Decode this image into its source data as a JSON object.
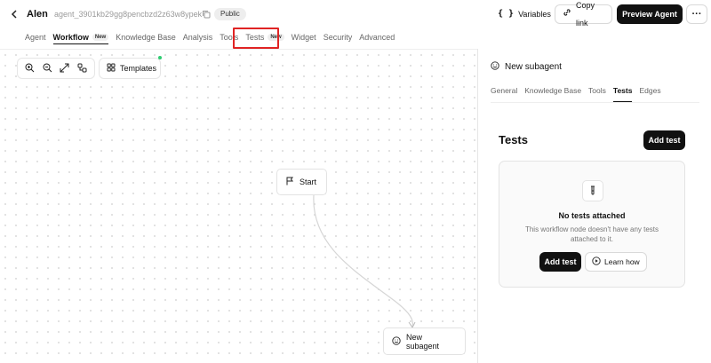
{
  "header": {
    "back_icon": "chevron-left-icon",
    "agent_name": "Alen",
    "agent_id": "agent_3901kb29gg8pencbzd2z63w8ypek",
    "visibility_badge": "Public",
    "variables_label": "Variables",
    "copy_link_label": "Copy link",
    "preview_label": "Preview Agent",
    "more_icon": "more-horizontal-icon"
  },
  "tabs": [
    {
      "label": "Agent"
    },
    {
      "label": "Workflow",
      "badge": "New"
    },
    {
      "label": "Knowledge Base"
    },
    {
      "label": "Analysis"
    },
    {
      "label": "Tools"
    },
    {
      "label": "Tests",
      "badge": "New"
    },
    {
      "label": "Widget"
    },
    {
      "label": "Security"
    },
    {
      "label": "Advanced"
    }
  ],
  "canvas": {
    "templates_label": "Templates",
    "start_node_label": "Start",
    "subagent_node_label": "New subagent"
  },
  "panel": {
    "title": "New subagent",
    "tabs": [
      "General",
      "Knowledge Base",
      "Tools",
      "Tests",
      "Edges"
    ],
    "active_tab": "Tests",
    "heading": "Tests",
    "add_test_label": "Add test",
    "empty_title": "No tests attached",
    "empty_desc": "This workflow node doesn't have any tests attached to it.",
    "learn_how_label": "Learn how"
  },
  "colors": {
    "highlight": "#e02424",
    "dark_button": "#111111",
    "dot": "#2ecc71"
  }
}
